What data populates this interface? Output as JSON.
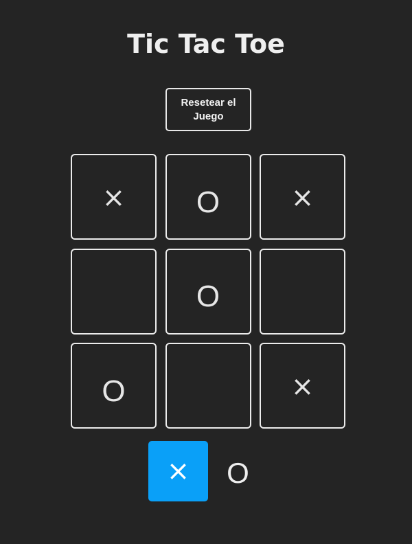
{
  "title": "Tic Tac Toe",
  "reset_button": {
    "label": "Resetear el Juego"
  },
  "board": [
    {
      "mark": "×",
      "type": "x"
    },
    {
      "mark": "O",
      "type": "o"
    },
    {
      "mark": "×",
      "type": "x"
    },
    {
      "mark": "",
      "type": ""
    },
    {
      "mark": "O",
      "type": "o"
    },
    {
      "mark": "",
      "type": ""
    },
    {
      "mark": "O",
      "type": "o"
    },
    {
      "mark": "",
      "type": ""
    },
    {
      "mark": "×",
      "type": "x"
    }
  ],
  "turn_indicator": {
    "x_label": "×",
    "o_label": "O",
    "active": "x",
    "active_color": "#0aa0f8"
  },
  "colors": {
    "background": "#242424",
    "text": "#ececec",
    "accent": "#0aa0f8"
  }
}
